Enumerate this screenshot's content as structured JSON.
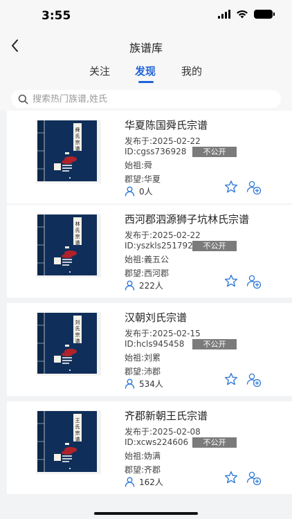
{
  "status": {
    "time": "3:55"
  },
  "header": {
    "title": "族谱库"
  },
  "tabs": [
    {
      "label": "关注",
      "active": false
    },
    {
      "label": "发现",
      "active": true
    },
    {
      "label": "我的",
      "active": false
    }
  ],
  "search": {
    "placeholder": "搜索热门族谱,姓氏"
  },
  "colors": {
    "accent": "#1e63d6",
    "badge": "#7b7b7b",
    "cover": "#0f2f5a"
  },
  "genealogies": [
    {
      "title": "华夏陈国舜氏宗谱",
      "cover_label": "舜氏宗谱",
      "date": "发布于:2025-02-22",
      "id": "ID:cgss736928",
      "visibility": "不公开",
      "ancestor": "始祖:舜",
      "region": "郡望:华夏",
      "followers": "0人"
    },
    {
      "title": "西河郡泗源狮子坑林氏宗谱",
      "cover_label": "林氏宗谱",
      "date": "发布于:2025-02-22",
      "id": "ID:yszkls251792",
      "visibility": "不公开",
      "ancestor": "始祖:義五公",
      "region": "郡望:西河郡",
      "followers": "222人"
    },
    {
      "title": "汉朝刘氏宗谱",
      "cover_label": "刘氏宗谱",
      "date": "发布于:2025-02-15",
      "id": "ID:hcls945458",
      "visibility": "不公开",
      "ancestor": "始祖:刘累",
      "region": "郡望:沛郡",
      "followers": "534人"
    },
    {
      "title": "齐郡新朝王氏宗谱",
      "cover_label": "王氏宗谱",
      "date": "发布于:2025-02-08",
      "id": "ID:xcws224606",
      "visibility": "不公开",
      "ancestor": "始祖:妫满",
      "region": "郡望:齐郡",
      "followers": "162人"
    }
  ]
}
